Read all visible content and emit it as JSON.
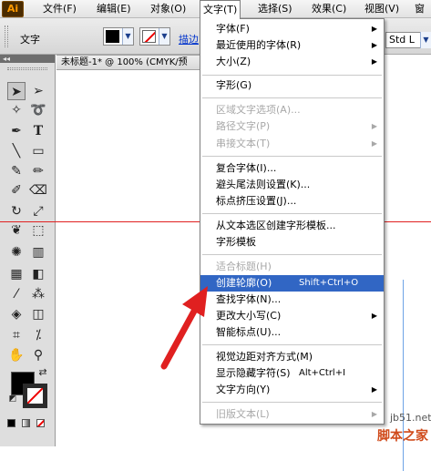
{
  "app": {
    "logo": "Ai"
  },
  "menubar": {
    "items": [
      {
        "label": "文件(F)"
      },
      {
        "label": "编辑(E)"
      },
      {
        "label": "对象(O)"
      },
      {
        "label": "文字(T)"
      },
      {
        "label": "选择(S)"
      },
      {
        "label": "效果(C)"
      },
      {
        "label": "视图(V)"
      },
      {
        "label": "窗"
      }
    ]
  },
  "controlbar": {
    "tool_label": "文字",
    "fill_color": "#000000",
    "stroke_color": "none",
    "description_link": "描边",
    "style_value": "Std L"
  },
  "document_tab": {
    "title": "未标题-1* @ 100% (CMYK/预"
  },
  "type_menu": {
    "items": [
      {
        "label": "字体(F)",
        "submenu": true,
        "enabled": true
      },
      {
        "label": "最近使用的字体(R)",
        "submenu": true,
        "enabled": true
      },
      {
        "label": "大小(Z)",
        "submenu": true,
        "enabled": true
      },
      {
        "label": "字形(G)",
        "submenu": false,
        "enabled": true
      },
      {
        "label": "区域文字选项(A)...",
        "submenu": false,
        "enabled": false
      },
      {
        "label": "路径文字(P)",
        "submenu": true,
        "enabled": false
      },
      {
        "label": "串接文本(T)",
        "submenu": true,
        "enabled": false
      },
      {
        "label": "复合字体(I)...",
        "submenu": false,
        "enabled": true
      },
      {
        "label": "避头尾法则设置(K)...",
        "submenu": false,
        "enabled": true
      },
      {
        "label": "标点挤压设置(J)...",
        "submenu": false,
        "enabled": true
      },
      {
        "label": "从文本选区创建字形模板...",
        "submenu": false,
        "enabled": true
      },
      {
        "label": "字形模板",
        "submenu": false,
        "enabled": true
      },
      {
        "label": "适合标题(H)",
        "submenu": false,
        "enabled": false
      },
      {
        "label": "创建轮廓(O)",
        "shortcut": "Shift+Ctrl+O",
        "submenu": false,
        "enabled": true,
        "highlighted": true
      },
      {
        "label": "查找字体(N)...",
        "submenu": false,
        "enabled": true
      },
      {
        "label": "更改大小写(C)",
        "submenu": true,
        "enabled": true
      },
      {
        "label": "智能标点(U)...",
        "submenu": false,
        "enabled": true
      },
      {
        "label": "视觉边距对齐方式(M)",
        "submenu": false,
        "enabled": true
      },
      {
        "label": "显示隐藏字符(S)",
        "shortcut": "Alt+Ctrl+I",
        "submenu": false,
        "enabled": true
      },
      {
        "label": "文字方向(Y)",
        "submenu": true,
        "enabled": true
      },
      {
        "label": "旧版文本(L)",
        "submenu": true,
        "enabled": false
      }
    ]
  },
  "tools_panel": {
    "header": "◂◂",
    "fill_color": "#000000",
    "stroke_color": "none"
  },
  "annotation": {
    "arrow_color": "#e02020"
  },
  "watermark": {
    "site": "jb51.net",
    "name": "脚本之家"
  }
}
